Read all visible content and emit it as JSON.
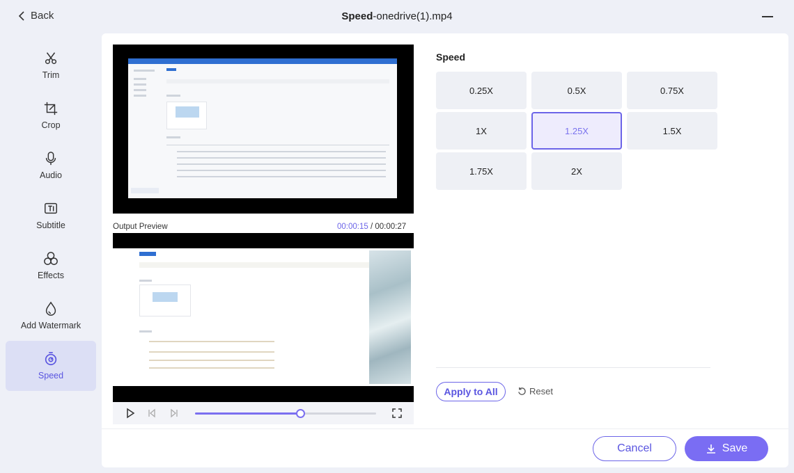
{
  "header": {
    "back_label": "Back",
    "title_bold": "Speed",
    "title_rest": "-onedrive(1).mp4"
  },
  "sidebar": {
    "items": [
      {
        "label": "Trim",
        "icon": "scissors-icon"
      },
      {
        "label": "Crop",
        "icon": "crop-icon"
      },
      {
        "label": "Audio",
        "icon": "microphone-icon"
      },
      {
        "label": "Subtitle",
        "icon": "subtitle-icon"
      },
      {
        "label": "Effects",
        "icon": "effects-icon"
      },
      {
        "label": "Add Watermark",
        "icon": "watermark-icon"
      },
      {
        "label": "Speed",
        "icon": "speed-icon",
        "active": true
      }
    ]
  },
  "preview": {
    "output_label": "Output Preview",
    "current_time": "00:00:15",
    "separator": " / ",
    "total_time": "00:00:27",
    "progress": 0.58
  },
  "speed": {
    "label": "Speed",
    "options": [
      "0.25X",
      "0.5X",
      "0.75X",
      "1X",
      "1.25X",
      "1.5X",
      "1.75X",
      "2X"
    ],
    "selected": "1.25X",
    "apply_all_label": "Apply to All",
    "reset_label": "Reset"
  },
  "footer": {
    "cancel_label": "Cancel",
    "save_label": "Save"
  },
  "colors": {
    "accent": "#6b64e8",
    "save_bg": "#7a6df3",
    "active_sidebar_bg": "#dcdff5"
  }
}
